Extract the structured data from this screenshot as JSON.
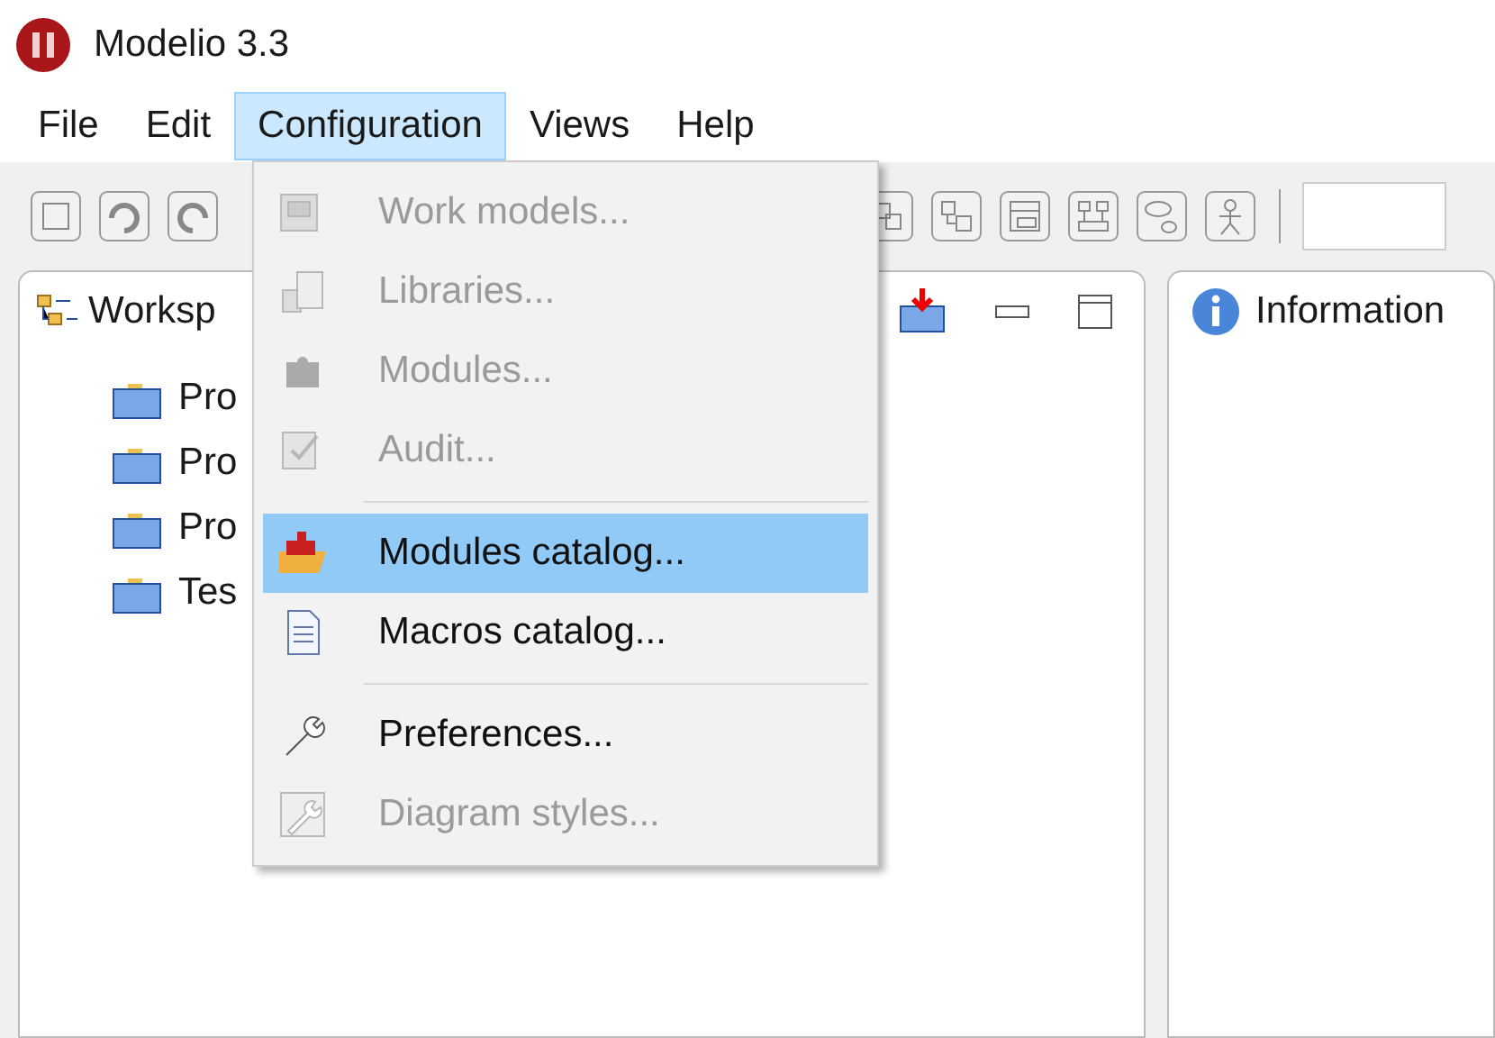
{
  "window": {
    "title": "Modelio 3.3"
  },
  "menubar": [
    {
      "label": "File",
      "selected": false
    },
    {
      "label": "Edit",
      "selected": false
    },
    {
      "label": "Configuration",
      "selected": true
    },
    {
      "label": "Views",
      "selected": false
    },
    {
      "label": "Help",
      "selected": false
    }
  ],
  "workspace_panel": {
    "title": "Worksp",
    "items": [
      {
        "label": "Pro"
      },
      {
        "label": "Pro"
      },
      {
        "label": "Pro"
      },
      {
        "label": "Tes"
      }
    ]
  },
  "information_panel": {
    "title": "Information"
  },
  "configuration_menu": {
    "groups": [
      [
        {
          "label": "Work models...",
          "disabled": true,
          "selected": false
        },
        {
          "label": "Libraries...",
          "disabled": true,
          "selected": false
        },
        {
          "label": "Modules...",
          "disabled": true,
          "selected": false
        },
        {
          "label": "Audit...",
          "disabled": true,
          "selected": false
        }
      ],
      [
        {
          "label": "Modules catalog...",
          "disabled": false,
          "selected": true
        },
        {
          "label": "Macros catalog...",
          "disabled": false,
          "selected": false
        }
      ],
      [
        {
          "label": "Preferences...",
          "disabled": false,
          "selected": false
        },
        {
          "label": "Diagram styles...",
          "disabled": true,
          "selected": false
        }
      ]
    ]
  }
}
